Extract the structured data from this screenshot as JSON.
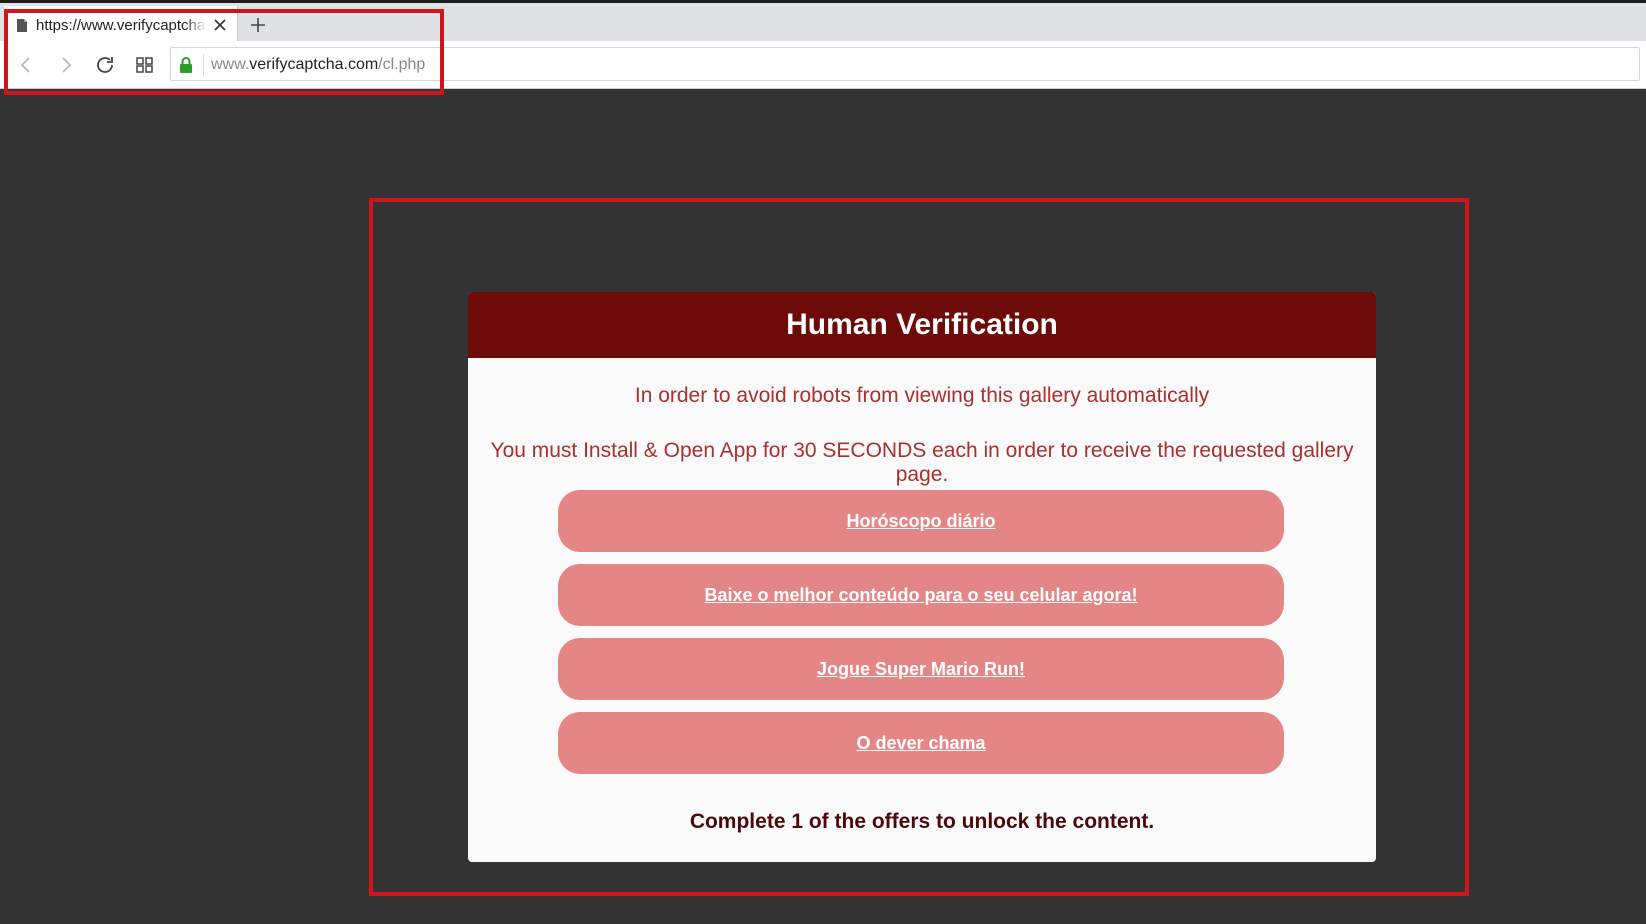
{
  "browser": {
    "tab_title": "https://www.verifycaptcha.com/cl.php",
    "url_prefix": "www.",
    "url_host": "verifycaptcha.com",
    "url_path": "/cl.php"
  },
  "card": {
    "title": "Human Verification",
    "message1": "In order to avoid robots from viewing this gallery automatically",
    "message2": "You must Install & Open App for 30 SECONDS each in order to receive the requested gallery page.",
    "offers": [
      {
        "label": "Horóscopo diário"
      },
      {
        "label": "Baixe o melhor conteúdo para o seu celular agora!"
      },
      {
        "label": "Jogue Super Mario Run!"
      },
      {
        "label": "O dever chama"
      }
    ],
    "footer": "Complete 1 of the offers to unlock the content."
  },
  "colors": {
    "header_bg": "#6d0a0a",
    "offer_button": "#e58686",
    "message_text": "#a8302f",
    "highlight_box": "#d0141b",
    "page_bg": "#333333"
  }
}
